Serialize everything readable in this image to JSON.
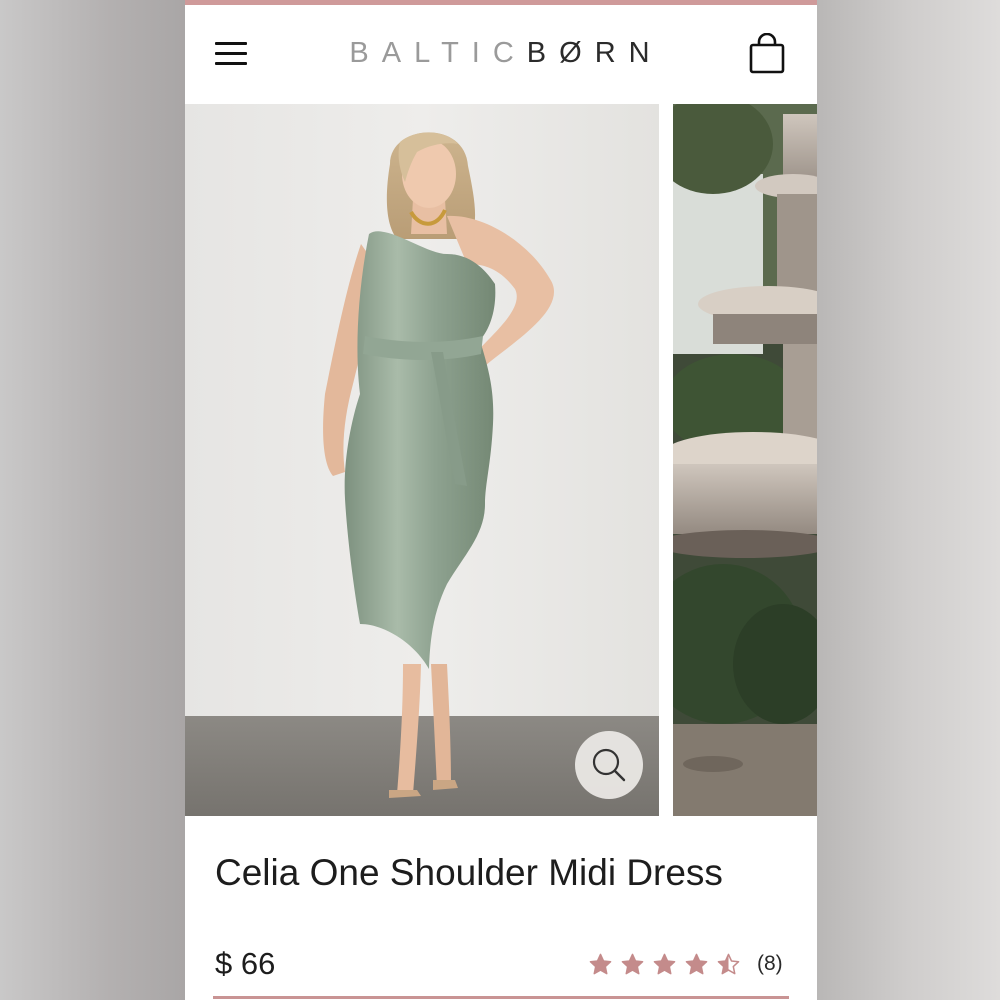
{
  "header": {
    "brand_part1": "BALTIC",
    "brand_part2": "BØRN"
  },
  "product": {
    "title": "Celia One Shoulder Midi Dress",
    "price": "$ 66",
    "rating": 4.5,
    "review_count": "(8)"
  },
  "gallery": {
    "main_image": "model in sage green satin one-shoulder wrap midi dress",
    "next_image": "stone garden fountain with greenery"
  },
  "colors": {
    "accent": "#cf9a9a",
    "star": "#c48b8b",
    "dress": "#8fa390"
  },
  "icons": [
    "hamburger-menu-icon",
    "shopping-bag-icon",
    "zoom-magnifier-icon",
    "star-icon"
  ]
}
